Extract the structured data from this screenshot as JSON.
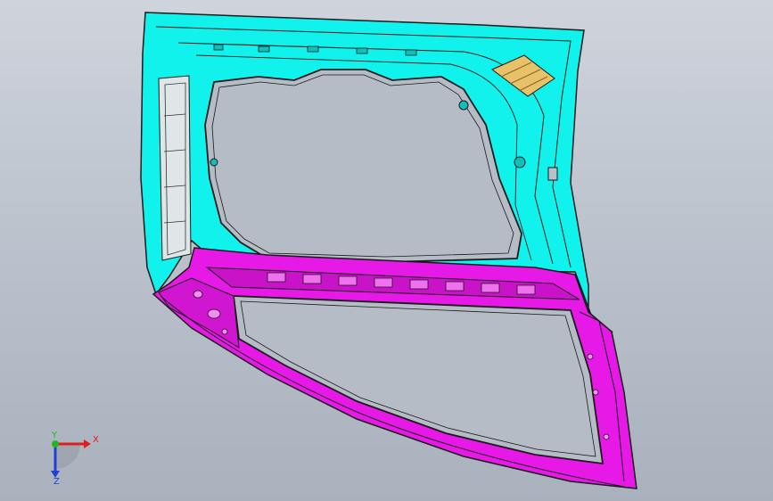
{
  "viewport": {
    "background_top": "#cfd4dc",
    "background_bottom": "#a9b1bd"
  },
  "model": {
    "upper_panel_color": "#12f2ec",
    "lower_panel_color": "#e619e6",
    "insert_color": "#e8c26a",
    "window_opening_color": "#b5bcc6",
    "edge_color": "#1a1a1a"
  },
  "triad": {
    "x_label": "X",
    "y_label": "Y",
    "z_label": "Z",
    "x_color": "#e01d1d",
    "y_color": "#1fb81f",
    "z_color": "#1f3fd6"
  }
}
